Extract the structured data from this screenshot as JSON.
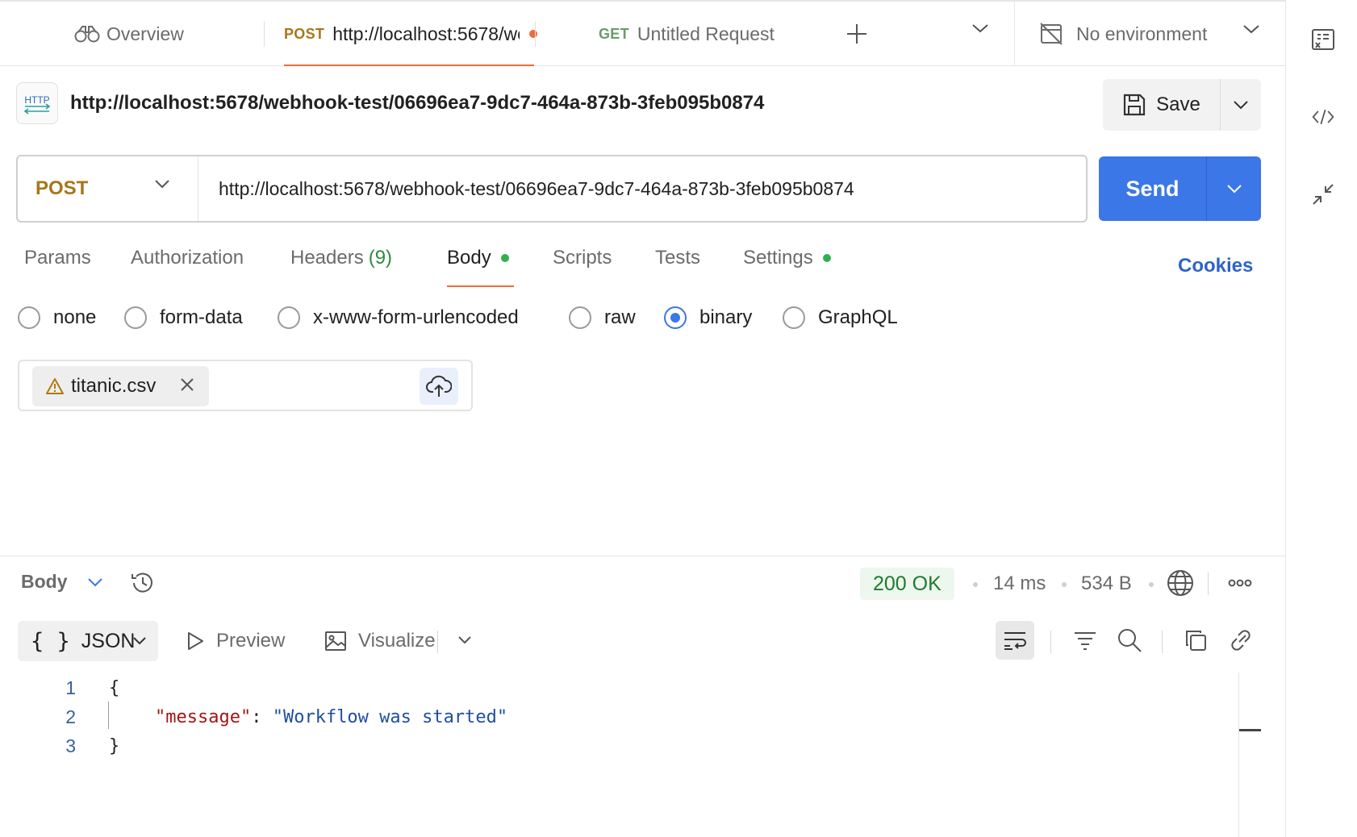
{
  "tabs": {
    "overview_label": "Overview",
    "active": {
      "method": "POST",
      "url": "http://localhost:5678/webhook-test/06696ea7-9dc7-464a-873b-3feb095b0874"
    },
    "second": {
      "method": "GET",
      "label": "Untitled Request"
    }
  },
  "environment": {
    "label": "No environment"
  },
  "request": {
    "title": "http://localhost:5678/webhook-test/06696ea7-9dc7-464a-873b-3feb095b0874",
    "method": "POST",
    "url": "http://localhost:5678/webhook-test/06696ea7-9dc7-464a-873b-3feb095b0874",
    "save_label": "Save",
    "send_label": "Send",
    "http_badge": "HTTP"
  },
  "subtabs": {
    "params": "Params",
    "authorization": "Authorization",
    "headers": "Headers",
    "headers_count": "(9)",
    "body": "Body",
    "scripts": "Scripts",
    "tests": "Tests",
    "settings": "Settings",
    "cookies": "Cookies"
  },
  "body_types": {
    "none": "none",
    "form_data": "form-data",
    "urlencoded": "x-www-form-urlencoded",
    "raw": "raw",
    "binary": "binary",
    "graphql": "GraphQL",
    "selected": "binary"
  },
  "file": {
    "name": "titanic.csv"
  },
  "response": {
    "title": "Body",
    "status": "200 OK",
    "time": "14 ms",
    "size": "534 B",
    "format": "JSON",
    "preview_label": "Preview",
    "visualize_label": "Visualize",
    "lines": [
      {
        "num": "1",
        "text": "{"
      },
      {
        "num": "2",
        "key": "\"message\"",
        "colon": ": ",
        "value": "\"Workflow was started\""
      },
      {
        "num": "3",
        "text": "}"
      }
    ]
  },
  "colors": {
    "accent": "#3b77e6",
    "post": "#a7761c",
    "active_tab": "#ef6a3a",
    "success": "#1f7a2e"
  }
}
